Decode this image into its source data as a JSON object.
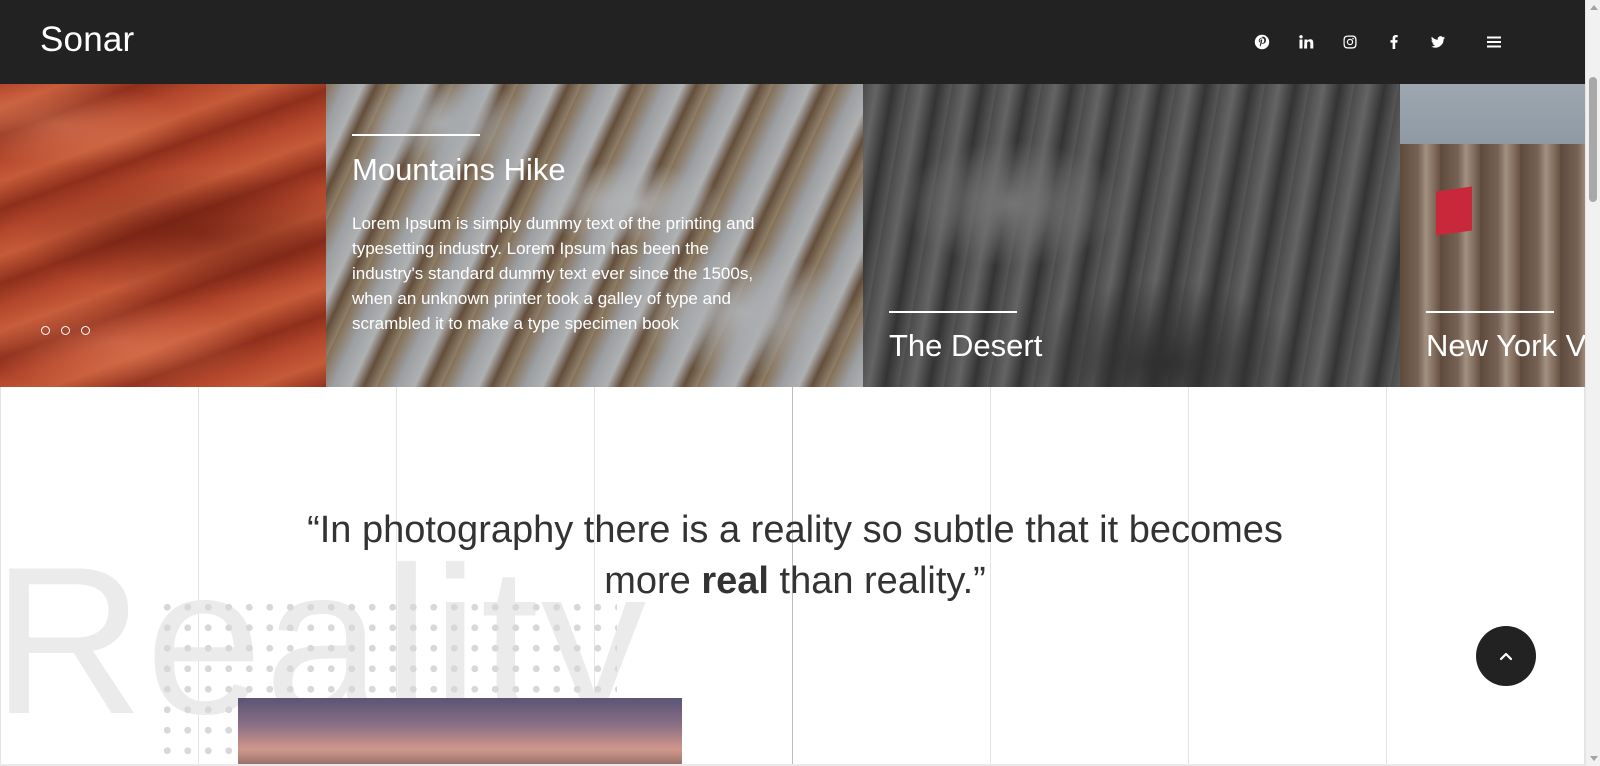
{
  "header": {
    "logo": "Sonar",
    "social": [
      {
        "name": "pinterest-icon"
      },
      {
        "name": "linkedin-icon"
      },
      {
        "name": "instagram-icon"
      },
      {
        "name": "facebook-icon"
      },
      {
        "name": "twitter-icon"
      }
    ],
    "menu_icon": "hamburger-menu-icon",
    "colors": {
      "bar": "#222222",
      "text": "#ffffff"
    }
  },
  "slider": {
    "dots_count": 3,
    "panels": [
      {
        "title": "Mountains Hike",
        "text": "Lorem Ipsum is simply dummy text of the printing and typesetting industry. Lorem Ipsum has been the industry's standard dummy text ever since the 1500s, when an unknown printer took a galley of type and scrambled it to make a type specimen book"
      },
      {
        "title": "The Desert"
      },
      {
        "title": "New York V"
      }
    ]
  },
  "quote": {
    "open": "“In photography there is a reality so subtle that it becomes more ",
    "bold": "real",
    "close": " than reality.”"
  },
  "background_word": "Reality",
  "scroll_top_icon": "chevron-up-icon"
}
